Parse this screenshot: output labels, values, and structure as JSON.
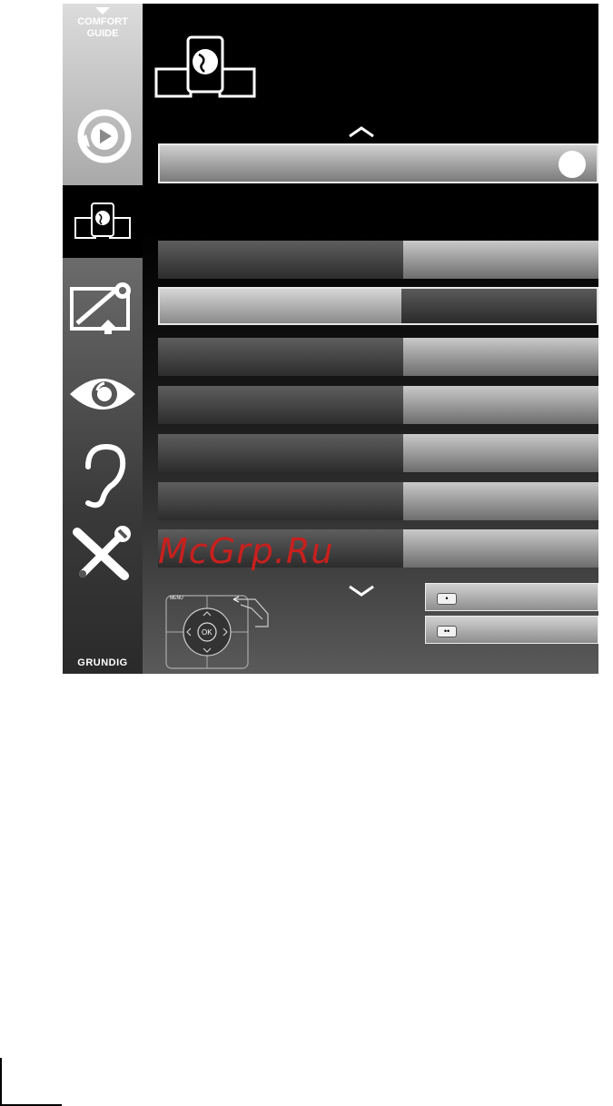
{
  "sidebar": {
    "comfort_guide": "COMFORT\nGUIDE",
    "comfort_line1": "COMFORT",
    "comfort_line2": "GUIDE",
    "brand": "GRUNDIG",
    "items": [
      {
        "icon": "playback-icon",
        "active": false
      },
      {
        "icon": "network-globe-icon",
        "active": true
      },
      {
        "icon": "source-input-icon",
        "active": false
      },
      {
        "icon": "picture-eye-icon",
        "active": false
      },
      {
        "icon": "sound-ear-icon",
        "active": false
      },
      {
        "icon": "tools-icon",
        "active": false
      }
    ]
  },
  "main": {
    "header_icon": "network-globe-icon",
    "scroll_up_icon": "chevron-up-icon",
    "scroll_down_icon": "chevron-down-icon",
    "rows_count_visible": 7
  },
  "buttons": [
    {
      "key": "•",
      "label": ""
    },
    {
      "key": "••",
      "label": ""
    }
  ],
  "remote": {
    "ok_label": "OK",
    "menu_label": "MENU"
  },
  "watermark": "McGrp.Ru",
  "colors": {
    "watermark": "#c8201e",
    "background": "#000000"
  }
}
